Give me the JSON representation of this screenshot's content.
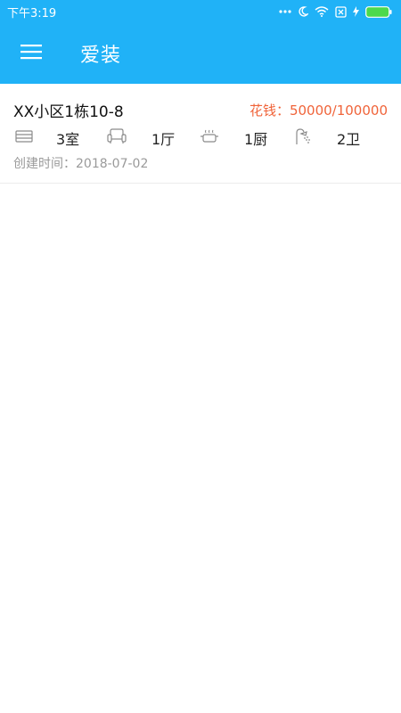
{
  "status_bar": {
    "time": "下午3:19",
    "icons": [
      "more-dots-icon",
      "moon-icon",
      "wifi-icon",
      "sim-x-icon",
      "charging-bolt-icon",
      "battery-icon"
    ],
    "accent": "#20b2f7",
    "battery_color": "#4cd94c"
  },
  "app_bar": {
    "title": "爱装",
    "menu_icon": "hamburger-menu-icon"
  },
  "projects": [
    {
      "name": "XX小区1栋10-8",
      "cost": "花钱：50000/100000",
      "rooms": {
        "bedroom": "3室",
        "living": "1厅",
        "kitchen": "1厨",
        "bath": "2卫"
      },
      "created": "创建时间：2018-07-02"
    }
  ],
  "colors": {
    "primary": "#20b2f7",
    "cost": "#f0643a",
    "muted": "#9a9a9a"
  }
}
